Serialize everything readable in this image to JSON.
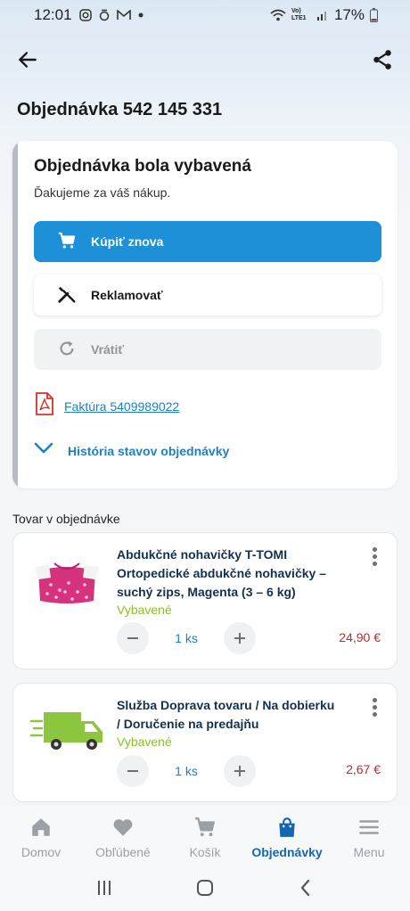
{
  "status_bar": {
    "time": "12:01",
    "battery": "17%",
    "network": "Vo) LTE1"
  },
  "header": {
    "order_title": "Objednávka 542 145 331"
  },
  "order_card": {
    "title": "Objednávka bola vybavená",
    "subtitle": "Ďakujeme za váš nákup.",
    "buy_again_label": "Kúpiť znova",
    "complaint_label": "Reklamovať",
    "return_label": "Vrátiť",
    "invoice_label": "Faktúra 5409989022",
    "history_label": "História stavov objednávky"
  },
  "items_section": {
    "label": "Tovar v objednávke"
  },
  "products": [
    {
      "name": "Abdukčné nohavičky T-TOMI Ortopedické abdukčné nohavičky – suchý zips, Magenta (3 – 6 kg)",
      "status": "Vybavené",
      "quantity": "1 ks",
      "price": "24,90 €"
    },
    {
      "name": "Služba Doprava tovaru / Na dobierku / Doručenie na predajňu",
      "status": "Vybavené",
      "quantity": "1 ks",
      "price": "2,67 €"
    }
  ],
  "bottom_nav": {
    "items": [
      {
        "label": "Domov",
        "icon": "home-icon"
      },
      {
        "label": "Obľúbené",
        "icon": "heart-icon"
      },
      {
        "label": "Košík",
        "icon": "cart-icon"
      },
      {
        "label": "Objednávky",
        "icon": "shopping-bag-icon",
        "active": true
      },
      {
        "label": "Menu",
        "icon": "hamburger-icon"
      }
    ]
  },
  "colors": {
    "primary": "#1e90d8",
    "link": "#1e7fc4",
    "price": "#c0272d",
    "status_ok": "#8cbf26",
    "nav_active": "#1565b0"
  }
}
